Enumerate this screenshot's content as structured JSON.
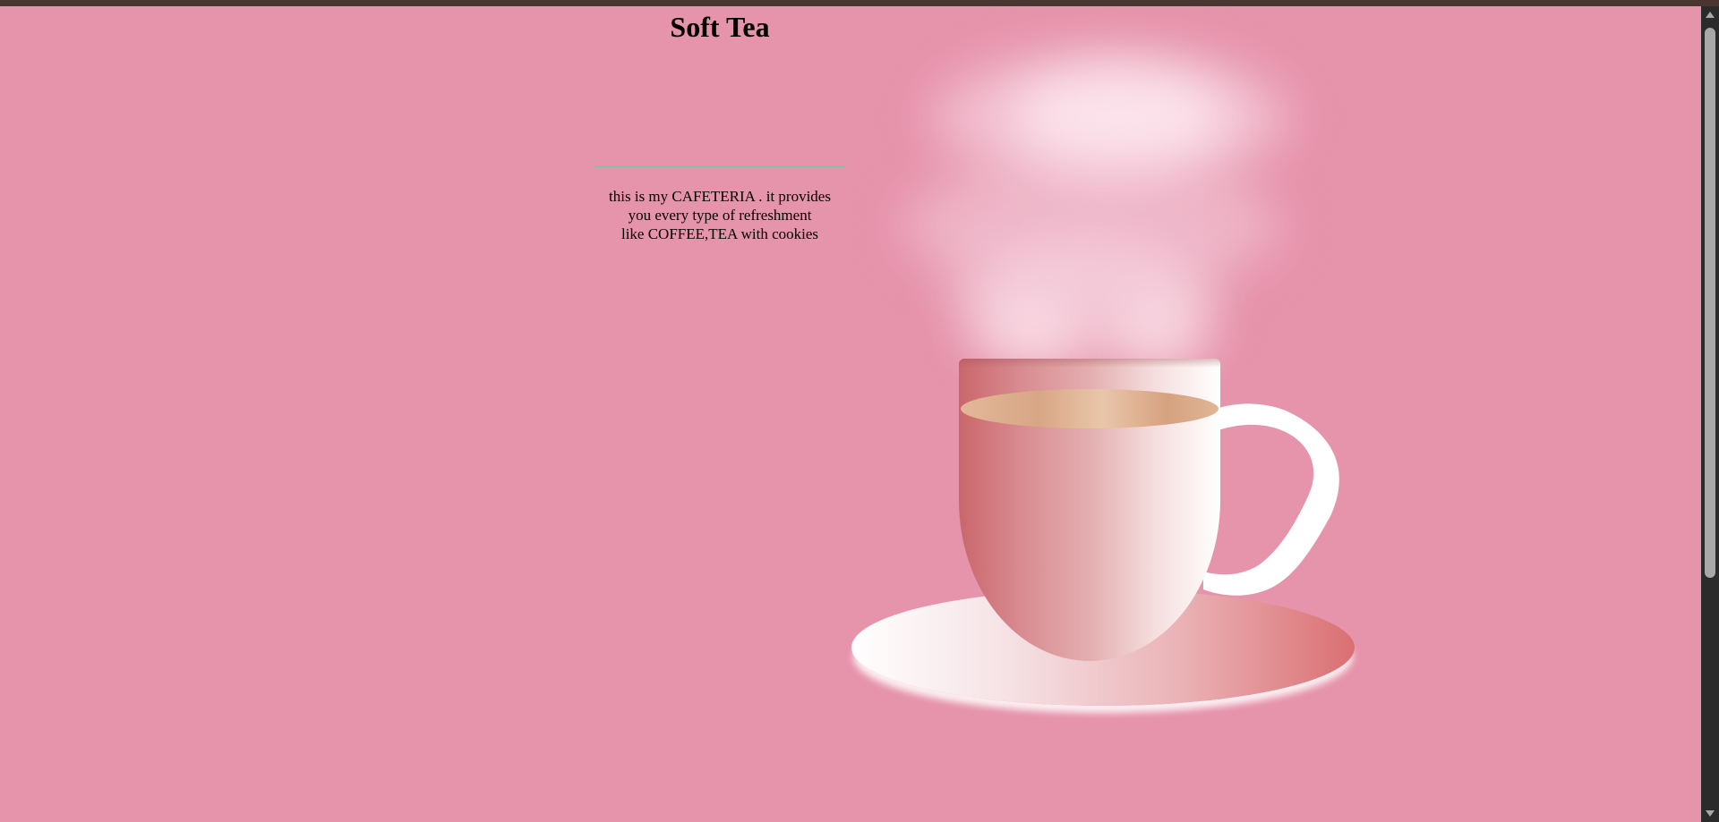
{
  "page": {
    "title": "Soft Tea",
    "description_lines": [
      "this is my CAFETERIA . it provides",
      "you every type of refreshment",
      "like COFFEE,TEA with cookies"
    ]
  },
  "colors": {
    "background": "#e693ac",
    "top_bar": "#4a3530",
    "divider": "#7fbfb5",
    "saucer_light": "#ffffff",
    "saucer_dark": "#da6f72",
    "cup_dark": "#c9676b",
    "cup_light": "#ffffff",
    "liquid": "#d8a684",
    "handle": "#ffffff"
  },
  "illustration": {
    "subject": "tea-cup-with-steam"
  }
}
